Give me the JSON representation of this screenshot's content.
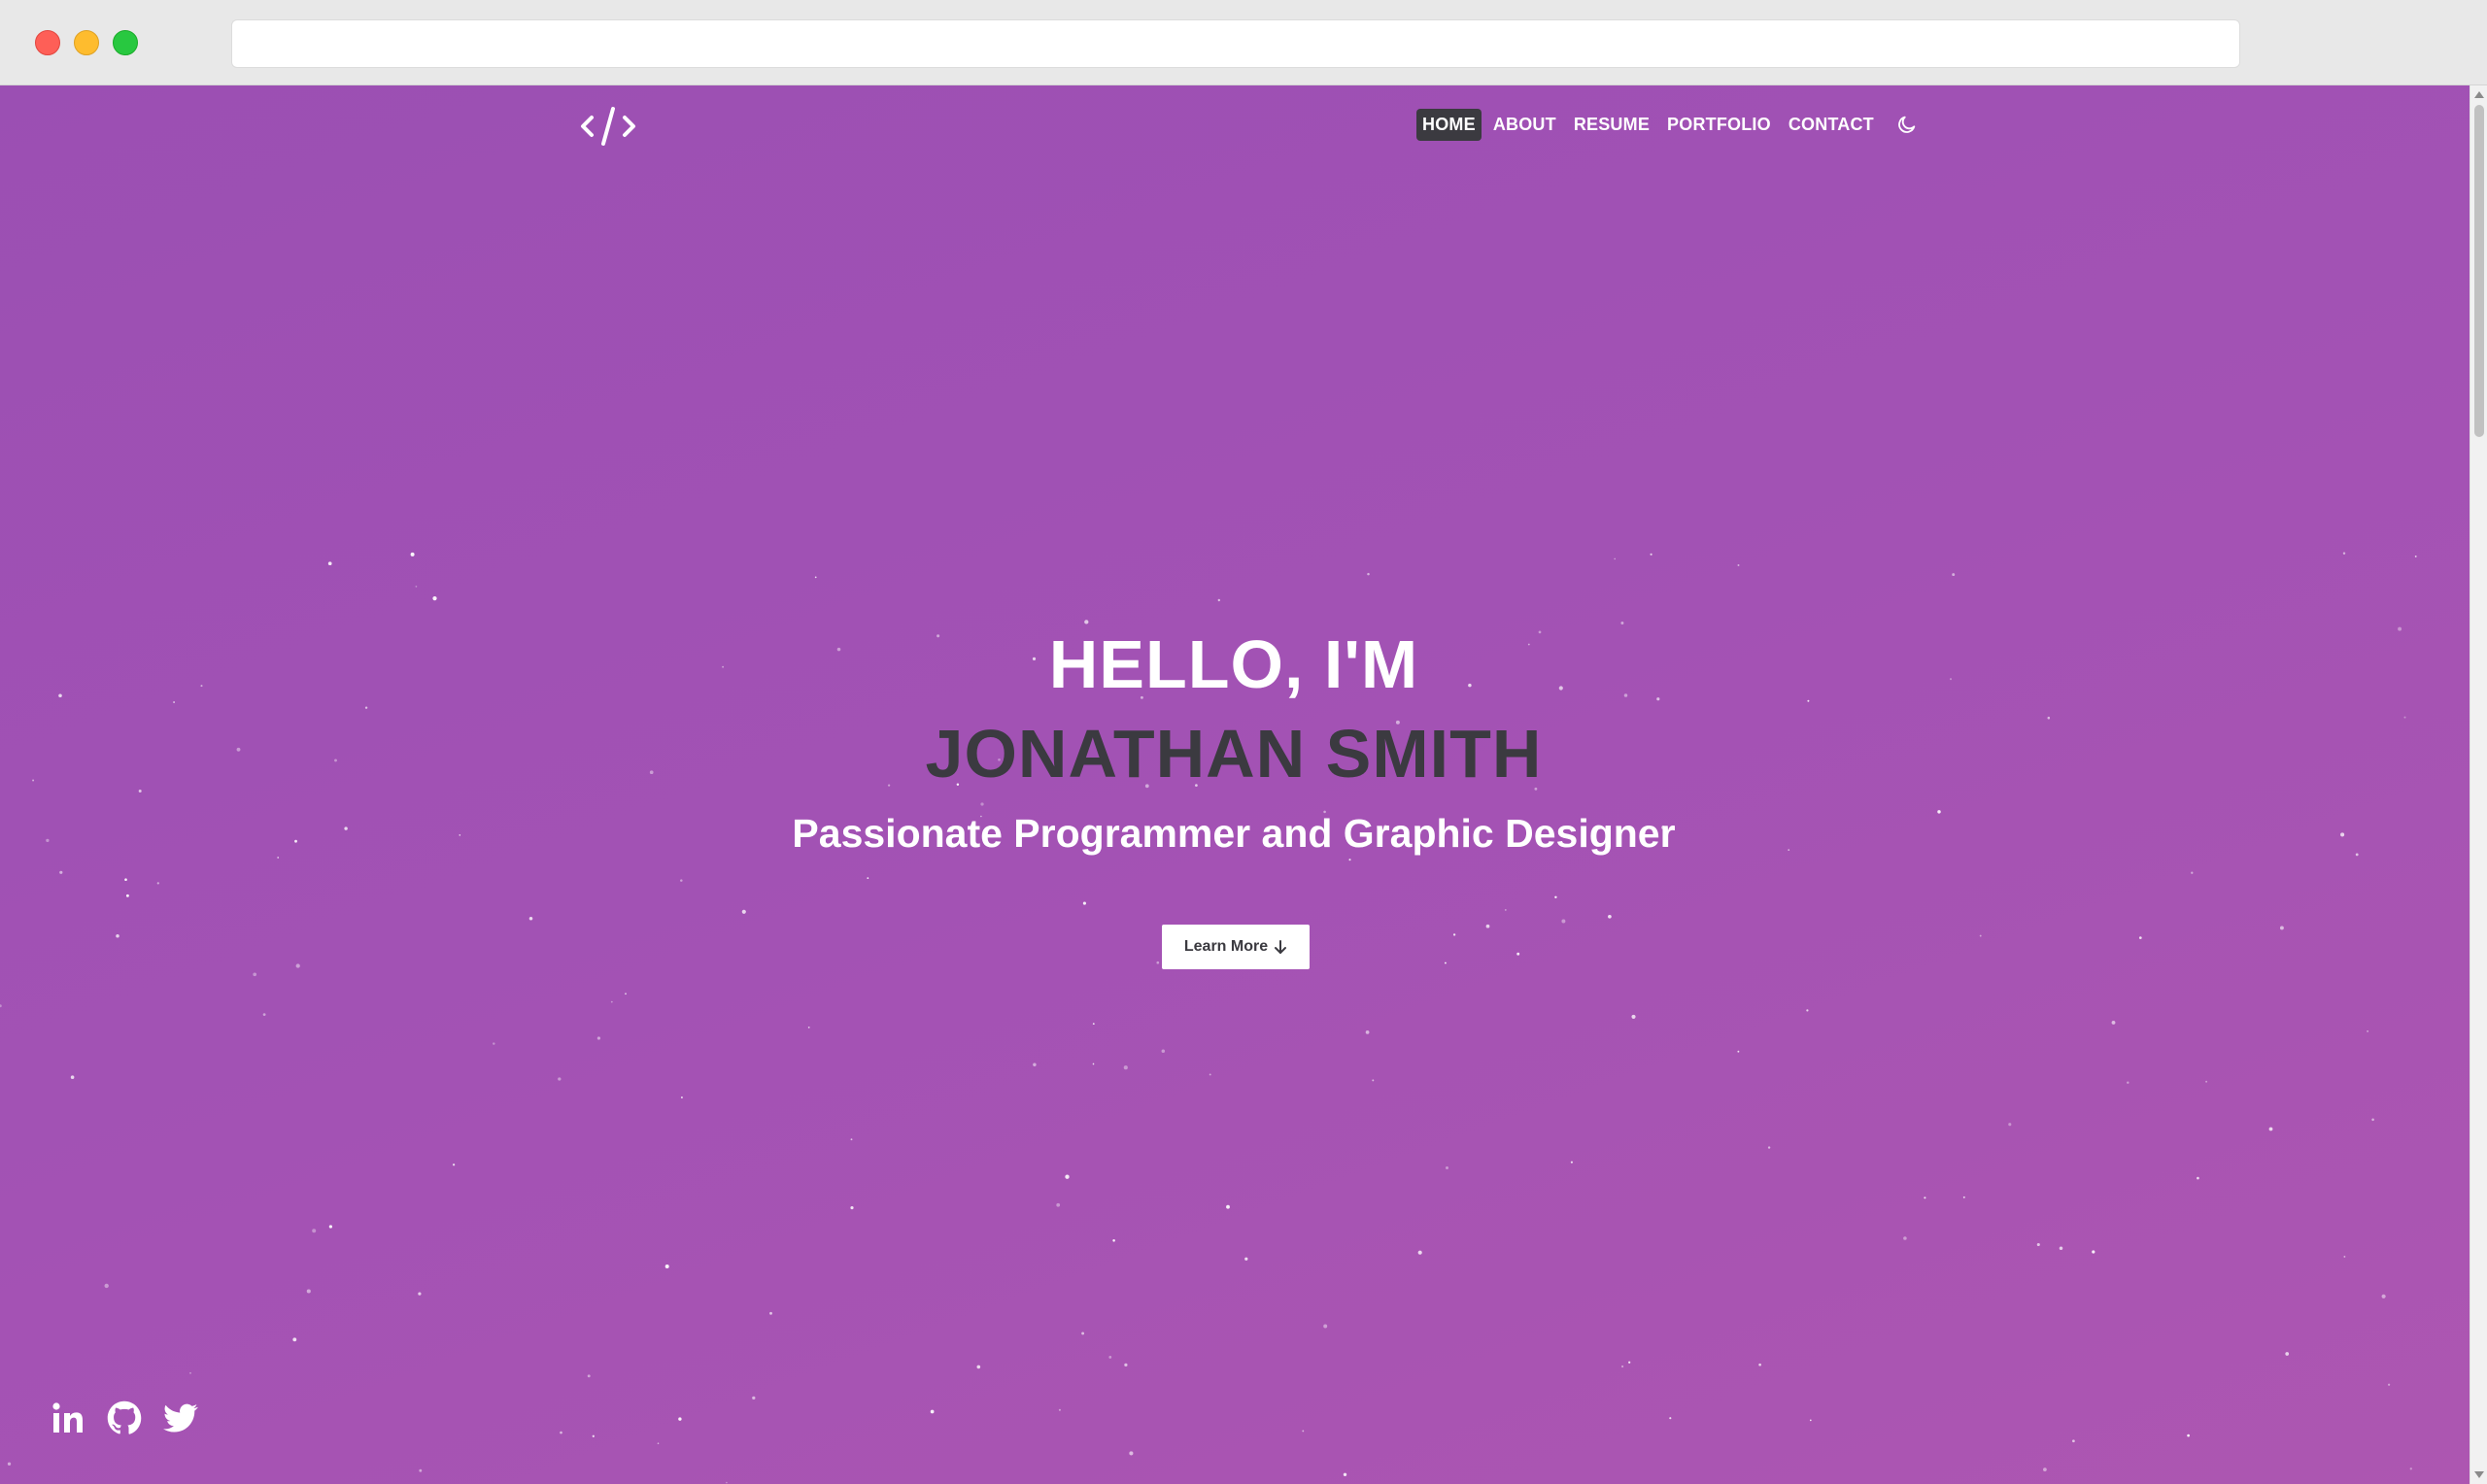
{
  "nav": {
    "items": [
      {
        "label": "HOME",
        "active": true
      },
      {
        "label": "ABOUT",
        "active": false
      },
      {
        "label": "RESUME",
        "active": false
      },
      {
        "label": "PORTFOLIO",
        "active": false
      },
      {
        "label": "CONTACT",
        "active": false
      }
    ],
    "logo_icon": "code-brackets-icon",
    "theme_icon": "moon-icon"
  },
  "hero": {
    "greeting": "HELLO, I'M",
    "name": "JONATHAN SMITH",
    "tagline": "Passionate Programmer and Graphic Designer",
    "button_label": "Learn More",
    "button_icon": "arrow-down-icon"
  },
  "social": [
    "linkedin-icon",
    "github-icon",
    "twitter-icon"
  ],
  "colors": {
    "background": "#a352b4",
    "accent_dark": "#3b3a40",
    "text_light": "#ffffff"
  }
}
